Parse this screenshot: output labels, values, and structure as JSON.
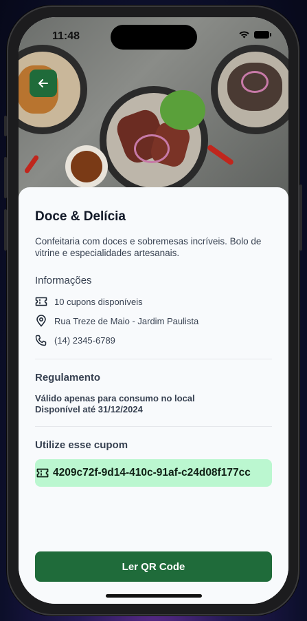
{
  "status": {
    "time": "11:48"
  },
  "place": {
    "name": "Doce & Delícia",
    "description": "Confeitaria com doces e sobremesas incríveis. Bolo de vitrine e especialidades artesanais."
  },
  "info": {
    "heading": "Informações",
    "coupons": "10 cupons disponíveis",
    "address": "Rua Treze de Maio - Jardim Paulista",
    "phone": "(14) 2345-6789"
  },
  "rules": {
    "heading": "Regulamento",
    "line1": "Válido apenas para consumo no local",
    "line2": "Disponível até 31/12/2024"
  },
  "coupon": {
    "heading": "Utilize esse cupom",
    "code": "4209c72f-9d14-410c-91af-c24d08f177cc"
  },
  "actions": {
    "qr_label": "Ler QR Code"
  },
  "colors": {
    "accent": "#1f6b3a",
    "coupon_bg": "#bbf7d0",
    "sheet_bg": "#f8fafc"
  },
  "icons": [
    "back-arrow-icon",
    "ticket-icon",
    "map-pin-icon",
    "phone-icon",
    "wifi-icon",
    "battery-icon"
  ]
}
